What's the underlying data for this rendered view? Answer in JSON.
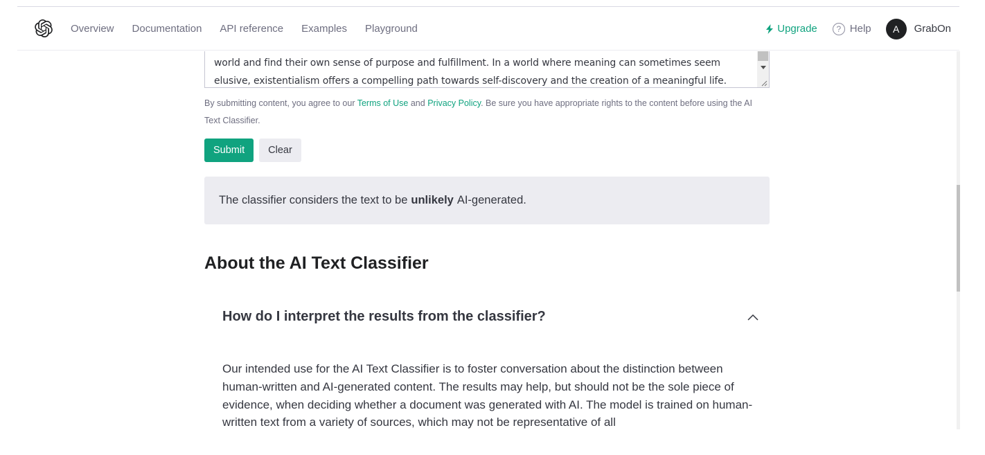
{
  "nav": {
    "logo": "openai-logo-icon",
    "links": [
      "Overview",
      "Documentation",
      "API reference",
      "Examples",
      "Playground"
    ],
    "upgrade": "Upgrade",
    "help": "Help",
    "help_icon_glyph": "?",
    "avatar_initial": "A",
    "username": "GrabOn"
  },
  "input": {
    "visible_text": "world and find their own sense of purpose and fulfillment. In a world where meaning can sometimes seem\nelusive, existentialism offers a compelling path towards self-discovery and the creation of a meaningful life."
  },
  "disclaimer": {
    "before_terms": "By submitting content, you agree to our ",
    "terms": "Terms of Use",
    "and": " and ",
    "privacy": "Privacy Policy",
    "after": ". Be sure you have appropriate rights to the content before using the AI Text Classifier."
  },
  "buttons": {
    "submit": "Submit",
    "clear": "Clear"
  },
  "result": {
    "prefix": "The classifier considers the text to be",
    "verdict": "unlikely",
    "suffix": "AI-generated."
  },
  "about": {
    "title": "About the AI Text Classifier",
    "faq": [
      {
        "question": "How do I interpret the results from the classifier?",
        "expanded": true,
        "answer": "Our intended use for the AI Text Classifier is to foster conversation about the distinction between human-written and AI-generated content. The results may help, but should not be the sole piece of evidence, when deciding whether a document was generated with AI. The model is trained on human-written text from a variety of sources, which may not be representative of all"
      }
    ]
  },
  "colors": {
    "accent": "#10a37f",
    "result_bg": "#ececf1",
    "avatar_bg": "#202123"
  }
}
